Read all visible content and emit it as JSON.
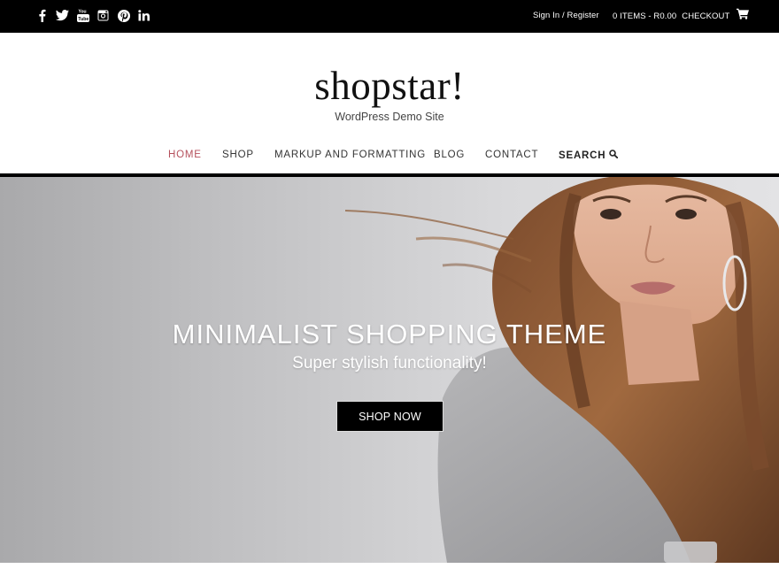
{
  "topbar": {
    "social_icons": [
      "facebook-icon",
      "twitter-icon",
      "youtube-icon",
      "instagram-icon",
      "pinterest-icon",
      "linkedin-icon"
    ],
    "signin_label": "Sign In / Register",
    "cart_items": "0 ITEMS",
    "cart_total": "R0.00",
    "checkout_label": "CHECKOUT"
  },
  "header": {
    "logo": "shopstar!",
    "tagline": "WordPress Demo Site"
  },
  "nav": {
    "items": [
      {
        "label": "HOME",
        "active": true
      },
      {
        "label": "SHOP"
      },
      {
        "label": "MARKUP AND FORMATTING"
      },
      {
        "label": "BLOG"
      },
      {
        "label": "CONTACT"
      },
      {
        "label": "SEARCH"
      }
    ],
    "active_color": "#b5505c"
  },
  "hero": {
    "title": "MINIMALIST SHOPPING THEME",
    "subtitle": "Super stylish functionality!",
    "button_label": "SHOP NOW"
  }
}
